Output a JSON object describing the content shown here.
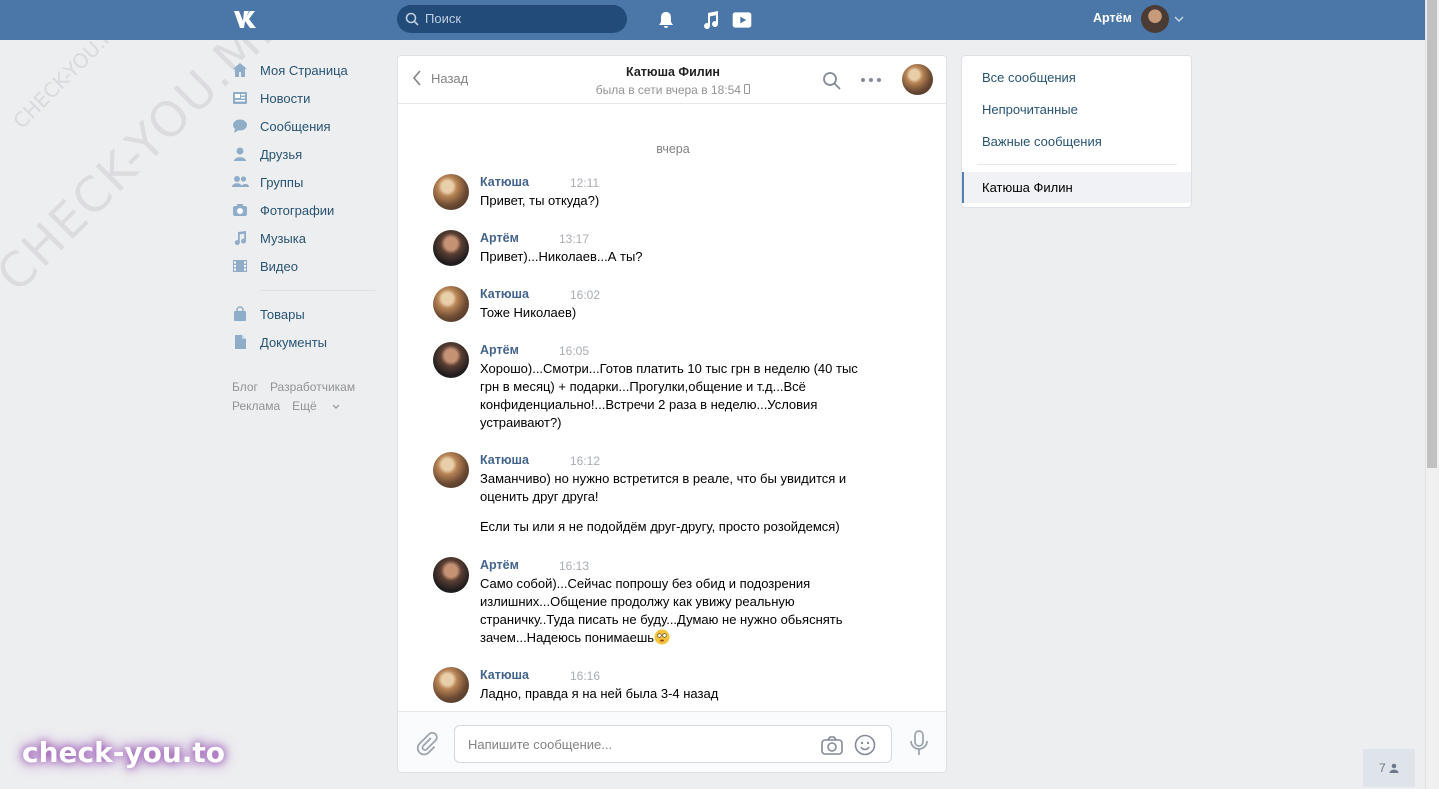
{
  "header": {
    "search_placeholder": "Поиск",
    "user_name": "Артём"
  },
  "left_menu": {
    "items": [
      {
        "label": "Моя Страница",
        "icon": "home-icon"
      },
      {
        "label": "Новости",
        "icon": "news-icon"
      },
      {
        "label": "Сообщения",
        "icon": "messages-icon"
      },
      {
        "label": "Друзья",
        "icon": "friends-icon"
      },
      {
        "label": "Группы",
        "icon": "groups-icon"
      },
      {
        "label": "Фотографии",
        "icon": "photos-icon"
      },
      {
        "label": "Музыка",
        "icon": "music-icon"
      },
      {
        "label": "Видео",
        "icon": "video-icon"
      }
    ],
    "items2": [
      {
        "label": "Товары",
        "icon": "market-icon"
      },
      {
        "label": "Документы",
        "icon": "documents-icon"
      }
    ],
    "footer": {
      "blog": "Блог",
      "developers": "Разработчикам",
      "ads": "Реклама",
      "more": "Ещё"
    }
  },
  "chat": {
    "back_label": "Назад",
    "title": "Катюша Филин",
    "status": "была в сети вчера в 18:54",
    "date_separator": "вчера",
    "input_placeholder": "Напишите сообщение...",
    "messages": [
      {
        "author": "Катюша",
        "time": "12:11",
        "text": "Привет, ты откуда?)"
      },
      {
        "author": "Артём",
        "time": "13:17",
        "text": "Привет)...Николаев...А ты?"
      },
      {
        "author": "Катюша",
        "time": "16:02",
        "text": "Тоже Николаев)"
      },
      {
        "author": "Артём",
        "time": "16:05",
        "text": "Хорошо)...Смотри...Готов платить 10 тыс грн в неделю (40 тыс грн в месяц) + подарки...Прогулки,общение и т.д...Всё конфиденциально!...Встречи 2 раза в неделю...Условия устраивают?)"
      },
      {
        "author": "Катюша",
        "time": "16:12",
        "text": "Заманчиво) но нужно встретится в реале, что бы увидится и оценить друг друга!",
        "text2": "Если ты или я не подойдём друг-другу, просто розойдемся)"
      },
      {
        "author": "Артём",
        "time": "16:13",
        "text": "Само собой)...Сейчас попрошу без обид и подозрения излишних...Общение продолжу как увижу реальную страничку..Туда писать не буду...Думаю не нужно обьяснять зачем...Надеюсь понимаешь"
      },
      {
        "author": "Катюша",
        "time": "16:16",
        "text": "Ладно, правда я на ней была 3-4 назад"
      }
    ]
  },
  "right_menu": {
    "all": "Все сообщения",
    "unread": "Непрочитанные",
    "important": "Важные сообщения",
    "active_dialog": "Катюша Филин"
  },
  "watermark": {
    "big": "CHECK-YOU.ME",
    "small": "CHECK-YOU.ME",
    "brand": "check-you.to"
  },
  "counter": "7",
  "colors": {
    "header": "#4a76a8",
    "link": "#285473",
    "author": "#42648b",
    "background": "#edeef0"
  }
}
